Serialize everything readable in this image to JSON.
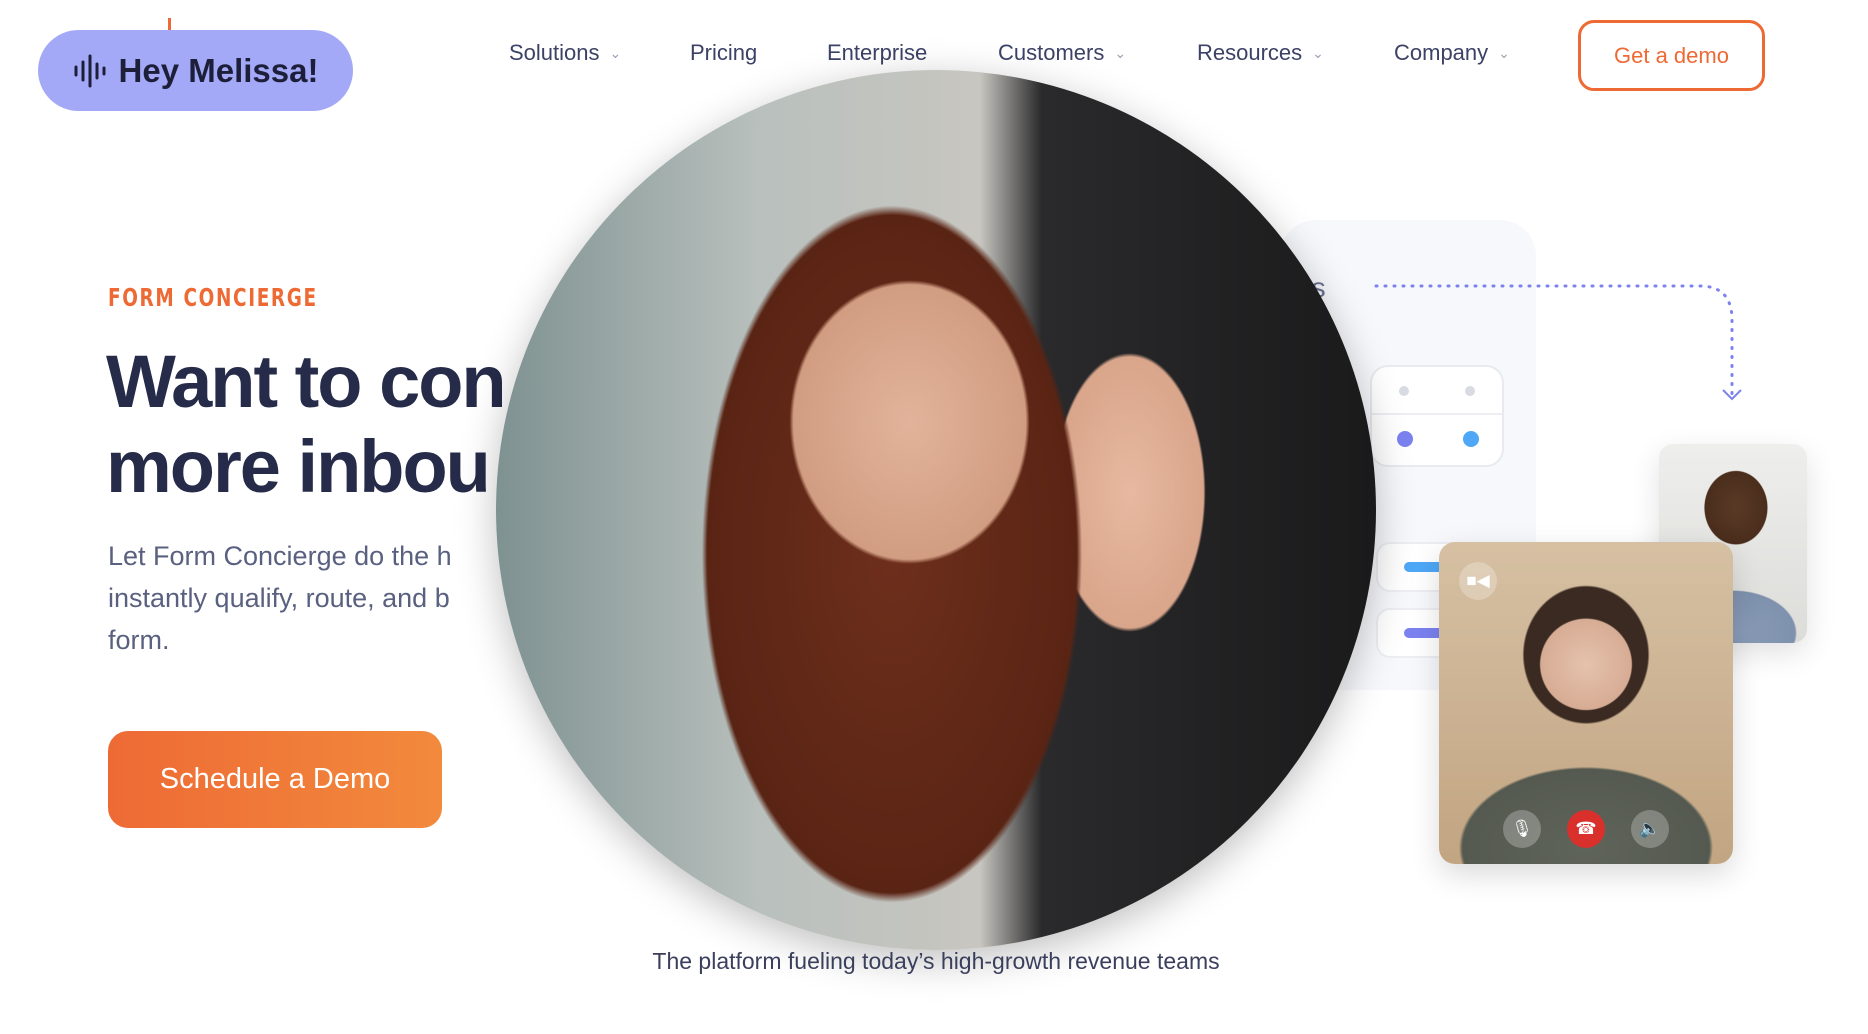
{
  "brand": {
    "label": "Hey Melissa!",
    "icon": "audio-wave-icon",
    "color": "#a3a9f7"
  },
  "nav": {
    "items": [
      {
        "label": "Solutions",
        "dropdown": true
      },
      {
        "label": "Pricing",
        "dropdown": false
      },
      {
        "label": "Enterprise",
        "dropdown": false
      },
      {
        "label": "Customers",
        "dropdown": true
      },
      {
        "label": "Resources",
        "dropdown": true
      },
      {
        "label": "Company",
        "dropdown": true
      }
    ],
    "cta_label": "Get a demo"
  },
  "hero": {
    "eyebrow": "FORM CONCIERGE",
    "headline_lines": [
      "Want to con",
      "more inbou"
    ],
    "body_lines": [
      "Let Form Concierge do the h",
      "instantly qualify, route, and b",
      "form."
    ],
    "cta_label": "Schedule a Demo",
    "accent_color": "#ee6a35"
  },
  "illustration": {
    "partial_label": "es"
  },
  "video_call": {
    "controls": [
      "mic-muted-icon",
      "hang-up-icon",
      "speaker-icon"
    ],
    "camera_icon": "video-camera-icon"
  },
  "caption": "The platform fueling today’s high-growth revenue teams"
}
